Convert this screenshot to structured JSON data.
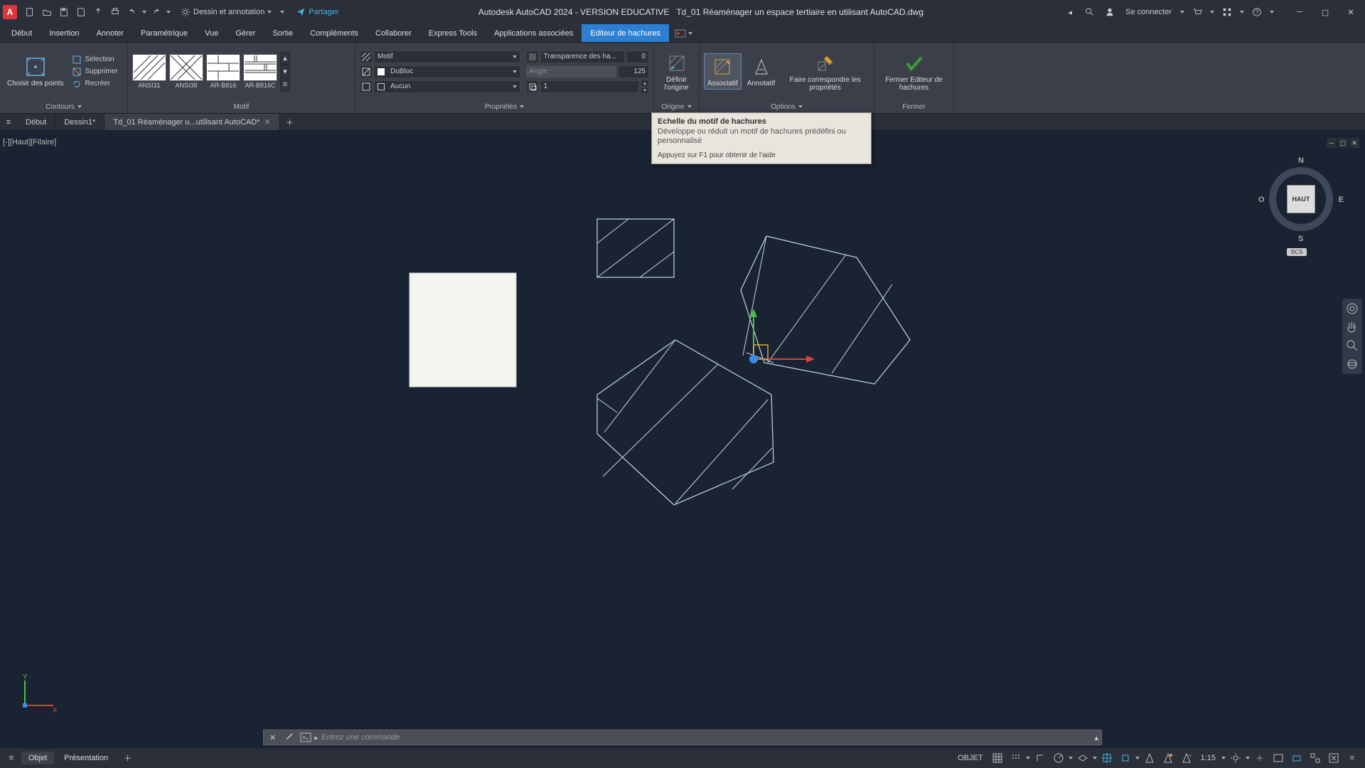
{
  "app": {
    "logo_letter": "A",
    "title": "Autodesk AutoCAD 2024 - VERSION EDUCATIVE",
    "document": "Td_01 Réaménager un espace tertiaire en utilisant AutoCAD.dwg",
    "workspace": "Dessin et annotation",
    "share": "Partager",
    "signin": "Se connecter"
  },
  "menu_tabs": [
    "Début",
    "Insertion",
    "Annoter",
    "Paramétrique",
    "Vue",
    "Gérer",
    "Sortie",
    "Compléments",
    "Collaborer",
    "Express Tools",
    "Applications associées",
    "Editeur de hachures"
  ],
  "ribbon": {
    "panel_contours": {
      "label": "Contours",
      "big": "Choisir des points",
      "items": [
        "Sélection",
        "Supprimer",
        "Recréer"
      ]
    },
    "panel_motif": {
      "label": "Motif",
      "swatches": [
        "ANSI31",
        "ANSI38",
        "AR-B816",
        "AR-B816C"
      ]
    },
    "panel_props": {
      "label": "Propriétés",
      "type_label": "Motif",
      "color_label": "DuBloc",
      "bg_label": "Aucun",
      "transparency_label": "Transparence des ha...",
      "transparency_value": "0",
      "angle_label": "Angle",
      "angle_value": "125",
      "scale_value": "1"
    },
    "panel_origin": {
      "label": "Origine",
      "btn": "Définir l'origine"
    },
    "panel_options": {
      "label": "Options",
      "assoc": "Associatif",
      "annot": "Annotatif",
      "match": "Faire correspondre les propriétés"
    },
    "panel_close": {
      "label": "Fermer",
      "btn": "Fermer Editeur de hachures"
    }
  },
  "file_tabs": {
    "items": [
      {
        "label": "Début",
        "active": false,
        "closable": false
      },
      {
        "label": "Dessin1*",
        "active": false,
        "closable": false
      },
      {
        "label": "Td_01 Réaménager u...utilisant AutoCAD*",
        "active": true,
        "closable": true
      }
    ]
  },
  "view_label": "[-][Haut][Filaire]",
  "viewcube": {
    "face": "HAUT",
    "n": "N",
    "s": "S",
    "e": "E",
    "o": "O",
    "bcs": "BCS"
  },
  "tooltip": {
    "title": "Echelle du motif de hachures",
    "desc": "Développe ou réduit un motif de hachures prédéfini ou personnalisé",
    "help": "Appuyez sur F1 pour obtenir de l'aide"
  },
  "command": {
    "placeholder": "Entrez une commande"
  },
  "status": {
    "layout_tabs": [
      "Objet",
      "Présentation"
    ],
    "objet": "OBJET",
    "scale": "1:15"
  }
}
